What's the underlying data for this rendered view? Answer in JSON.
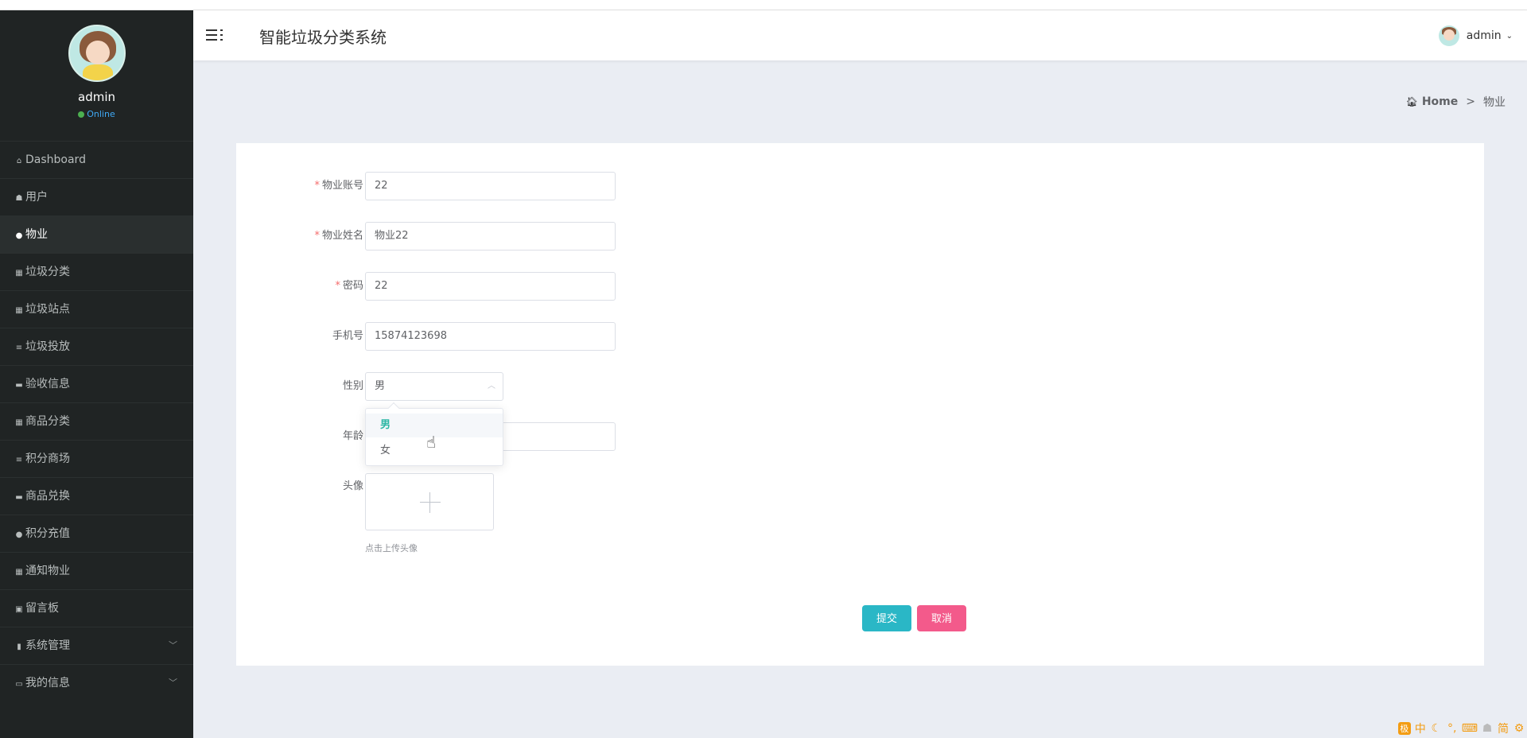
{
  "header": {
    "title": "智能垃圾分类系统",
    "user": "admin"
  },
  "sidebar": {
    "profile": {
      "name": "admin",
      "status": "Online"
    },
    "items": [
      {
        "label": "Dashboard",
        "icon": "⌂"
      },
      {
        "label": "用户",
        "icon": "☗"
      },
      {
        "label": "物业",
        "icon": "●"
      },
      {
        "label": "垃圾分类",
        "icon": "▦"
      },
      {
        "label": "垃圾站点",
        "icon": "▦"
      },
      {
        "label": "垃圾投放",
        "icon": "≡"
      },
      {
        "label": "验收信息",
        "icon": "▬"
      },
      {
        "label": "商品分类",
        "icon": "▦"
      },
      {
        "label": "积分商场",
        "icon": "≡"
      },
      {
        "label": "商品兑换",
        "icon": "▬"
      },
      {
        "label": "积分充值",
        "icon": "●"
      },
      {
        "label": "通知物业",
        "icon": "▦"
      },
      {
        "label": "留言板",
        "icon": "▣"
      },
      {
        "label": "系统管理",
        "icon": "▮"
      },
      {
        "label": "我的信息",
        "icon": "▭"
      }
    ]
  },
  "breadcrumb": {
    "home": "Home",
    "separator": ">",
    "current": "物业"
  },
  "form": {
    "account": {
      "label": "物业账号",
      "value": "22"
    },
    "name": {
      "label": "物业姓名",
      "value": "物业22"
    },
    "password": {
      "label": "密码",
      "value": "22"
    },
    "phone": {
      "label": "手机号",
      "value": "15874123698"
    },
    "gender": {
      "label": "性别",
      "value": "男",
      "options": [
        "男",
        "女"
      ]
    },
    "age": {
      "label": "年龄",
      "value": ""
    },
    "avatar": {
      "label": "头像",
      "hint": "点击上传头像"
    },
    "submit_label": "提交",
    "cancel_label": "取消"
  },
  "ime_toolbar": [
    "中",
    "简"
  ],
  "colors": {
    "sidebar": "#202424",
    "accent": "#2db7a5",
    "submit": "#2ab7c6",
    "cancel": "#f35a8b",
    "required": "#f56c6c"
  }
}
